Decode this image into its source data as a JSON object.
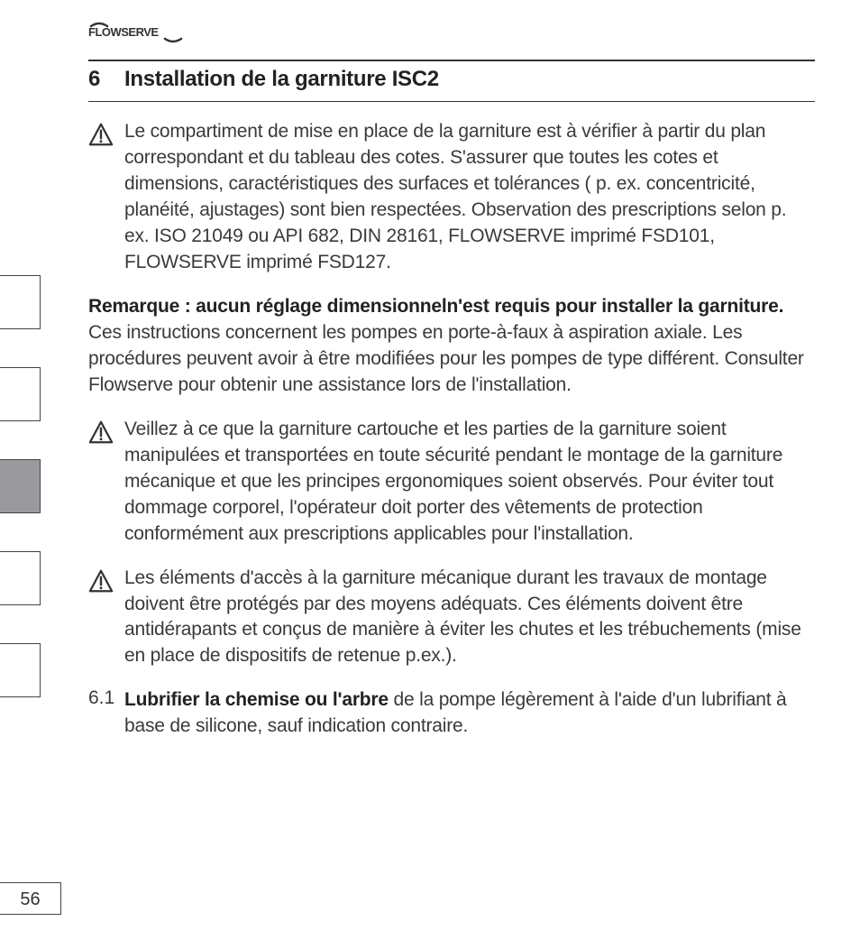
{
  "brand": "FLOWSERVE",
  "page_number": "56",
  "section": {
    "number": "6",
    "title": "Installation de la garniture ISC2"
  },
  "para_compartment": "Le compartiment de mise en place de la garniture est à vérifier à partir du plan correspondant et du tableau des cotes. S'assurer que toutes les cotes et dimensions, caractéristiques des surfaces et tolérances ( p. ex. concentricité, planéité, ajustages) sont bien respectées. Observation des prescriptions selon p. ex. ISO 21049 ou API 682, DIN 28161, FLOWSERVE imprimé FSD101, FLOWSERVE imprimé FSD127.",
  "remark_lead": "Remarque : aucun réglage dimensionneln'est requis pour installer la garniture.",
  "remark_rest": " Ces instructions concernent les pompes en porte-à-faux à aspiration axiale. Les procédures peuvent avoir à être modifiées pour les pompes de type différent. Consulter Flowserve pour obtenir une assistance lors de l'installation.",
  "para_cartouche": "Veillez à ce que la garniture cartouche et les parties de la garniture soient manipulées et transportées en toute sécurité pendant le montage de la garniture mécanique et que les principes ergonomiques soient observés. Pour éviter tout dommage corporel, l'opérateur doit porter des vêtements de protection conformément aux prescriptions applicables pour l'installation.",
  "para_acces": "Les éléments d'accès à la garniture mécanique durant les travaux de montage doivent être protégés par des moyens adéquats. Ces éléments doivent être antidérapants et conçus de manière à éviter les chutes et les trébuchements (mise en place de dispositifs de retenue p.ex.).",
  "sub_num": "6.1",
  "sub_lead": "Lubrifier la chemise ou l'arbre",
  "sub_rest": " de la pompe légèrement à l'aide d'un lubrifiant à base de silicone, sauf indication contraire."
}
